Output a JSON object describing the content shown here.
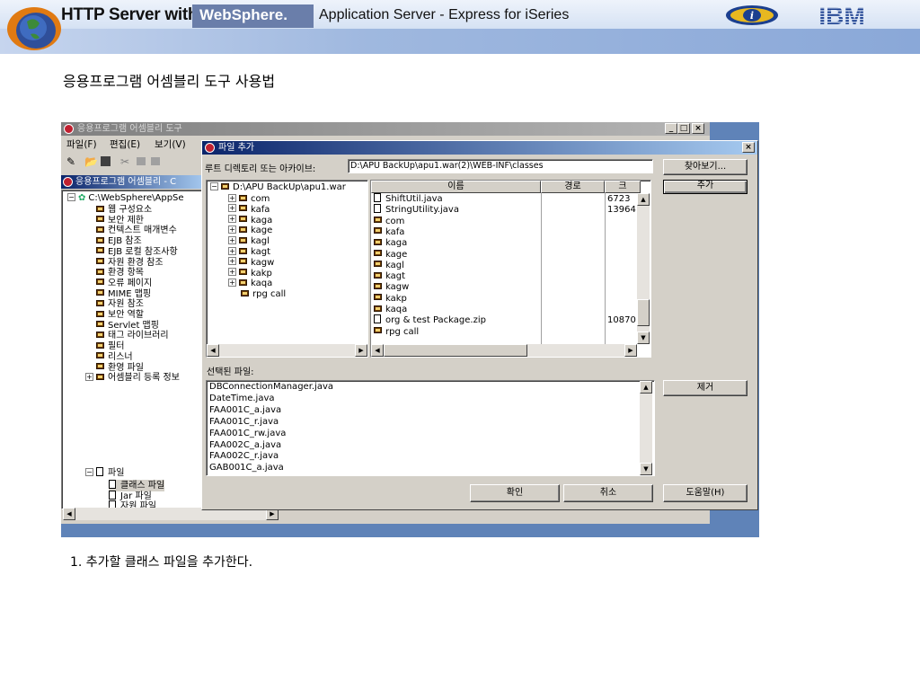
{
  "banner": {
    "title": "HTTP Server with",
    "websphere": "WebSphere.",
    "subtitle": "Application Server - Express for iSeries",
    "ibm": "IBM"
  },
  "slide": {
    "heading": "응용프로그램 어셈블리 도구 사용법",
    "caption": "1. 추가할 클래스 파일을 추가한다."
  },
  "main_window": {
    "title": "응용프로그램 어셈블리 도구",
    "menu": [
      "파일(F)",
      "편집(E)",
      "보기(V)"
    ],
    "panel_title": "응용프로그램 어셈블리 - C",
    "tree": {
      "root": "C:\\WebSphere\\AppSe",
      "items": [
        "웹 구성요소",
        "보안 제한",
        "컨텍스트 매개변수",
        "EJB 참조",
        "EJB 로컬 참조사항",
        "자원 환경 참조",
        "환경 항목",
        "오류 페이지",
        "MIME 맵핑",
        "자원 참조",
        "보안 역할",
        "Servlet 맵핑",
        "태그 라이브러리",
        "필터",
        "리스너",
        "환영 파일",
        "어셈블리 등록 정보"
      ],
      "file_node": "파일",
      "file_children": [
        "클래스 파일",
        "Jar 파일",
        "자원 파일"
      ]
    }
  },
  "dialog": {
    "title": "파일 추가",
    "root_label": "루트 디렉토리 또는 아카이브:",
    "root_value": "D:\\APU BackUp\\apu1.war(2)\\WEB-INF\\classes",
    "browse": "찾아보기...",
    "add": "추가",
    "remove": "제거",
    "dir_tree": {
      "root": "D:\\APU BackUp\\apu1.war",
      "folders": [
        "com",
        "kafa",
        "kaga",
        "kage",
        "kagl",
        "kagt",
        "kagw",
        "kakp",
        "kaqa",
        "rpg call"
      ]
    },
    "file_list": {
      "columns": [
        "이름",
        "경로",
        "크"
      ],
      "rows": [
        {
          "name": "ShiftUtil.java",
          "type": "file",
          "size": "6723"
        },
        {
          "name": "StringUtility.java",
          "type": "file",
          "size": "13964"
        },
        {
          "name": "com",
          "type": "folder",
          "size": ""
        },
        {
          "name": "kafa",
          "type": "folder",
          "size": ""
        },
        {
          "name": "kaga",
          "type": "folder",
          "size": ""
        },
        {
          "name": "kage",
          "type": "folder",
          "size": ""
        },
        {
          "name": "kagl",
          "type": "folder",
          "size": ""
        },
        {
          "name": "kagt",
          "type": "folder",
          "size": ""
        },
        {
          "name": "kagw",
          "type": "folder",
          "size": ""
        },
        {
          "name": "kakp",
          "type": "folder",
          "size": ""
        },
        {
          "name": "kaqa",
          "type": "folder",
          "size": ""
        },
        {
          "name": "org & test Package.zip",
          "type": "file",
          "size": "10870"
        },
        {
          "name": "rpg call",
          "type": "folder",
          "size": ""
        }
      ]
    },
    "selected_label": "선택된 파일:",
    "selected_files": [
      "DBConnectionManager.java",
      "DateTime.java",
      "FAA001C_a.java",
      "FAA001C_r.java",
      "FAA001C_rw.java",
      "FAA002C_a.java",
      "FAA002C_r.java",
      "GAB001C_a.java"
    ],
    "ok": "확인",
    "cancel": "취소",
    "help": "도움말(H)"
  }
}
